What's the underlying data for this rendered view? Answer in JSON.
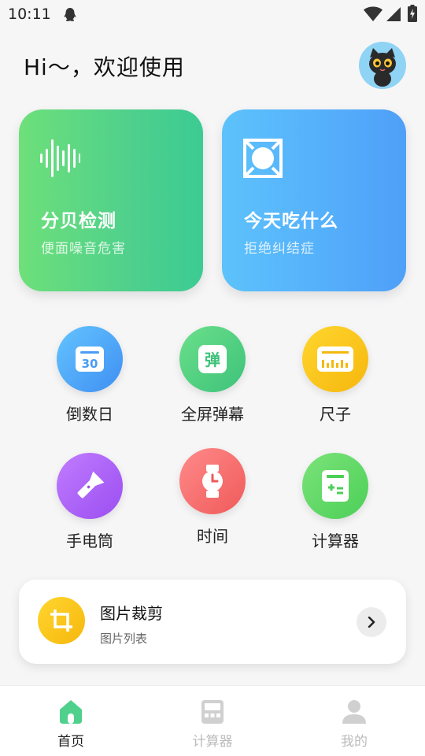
{
  "status_bar": {
    "time": "10:11"
  },
  "greeting": "Hi～，欢迎使用",
  "cards": {
    "decibel": {
      "title": "分贝检测",
      "subtitle": "便面噪音危害"
    },
    "eat": {
      "title": "今天吃什么",
      "subtitle": "拒绝纠结症"
    }
  },
  "tools": [
    {
      "label": "倒数日",
      "icon_text": "30"
    },
    {
      "label": "全屏弹幕",
      "icon_text": "弹"
    },
    {
      "label": "尺子"
    },
    {
      "label": "手电筒"
    },
    {
      "label": "时间"
    },
    {
      "label": "计算器"
    }
  ],
  "crop": {
    "title": "图片裁剪",
    "subtitle": "图片列表"
  },
  "nav": [
    {
      "label": "首页",
      "active": true
    },
    {
      "label": "计算器",
      "active": false
    },
    {
      "label": "我的",
      "active": false
    }
  ],
  "colors": {
    "decibel_card": "#4fd08c",
    "eat_card": "#55b0fb",
    "active_nav": "#4fd08c",
    "inactive_nav": "#cccccc"
  }
}
